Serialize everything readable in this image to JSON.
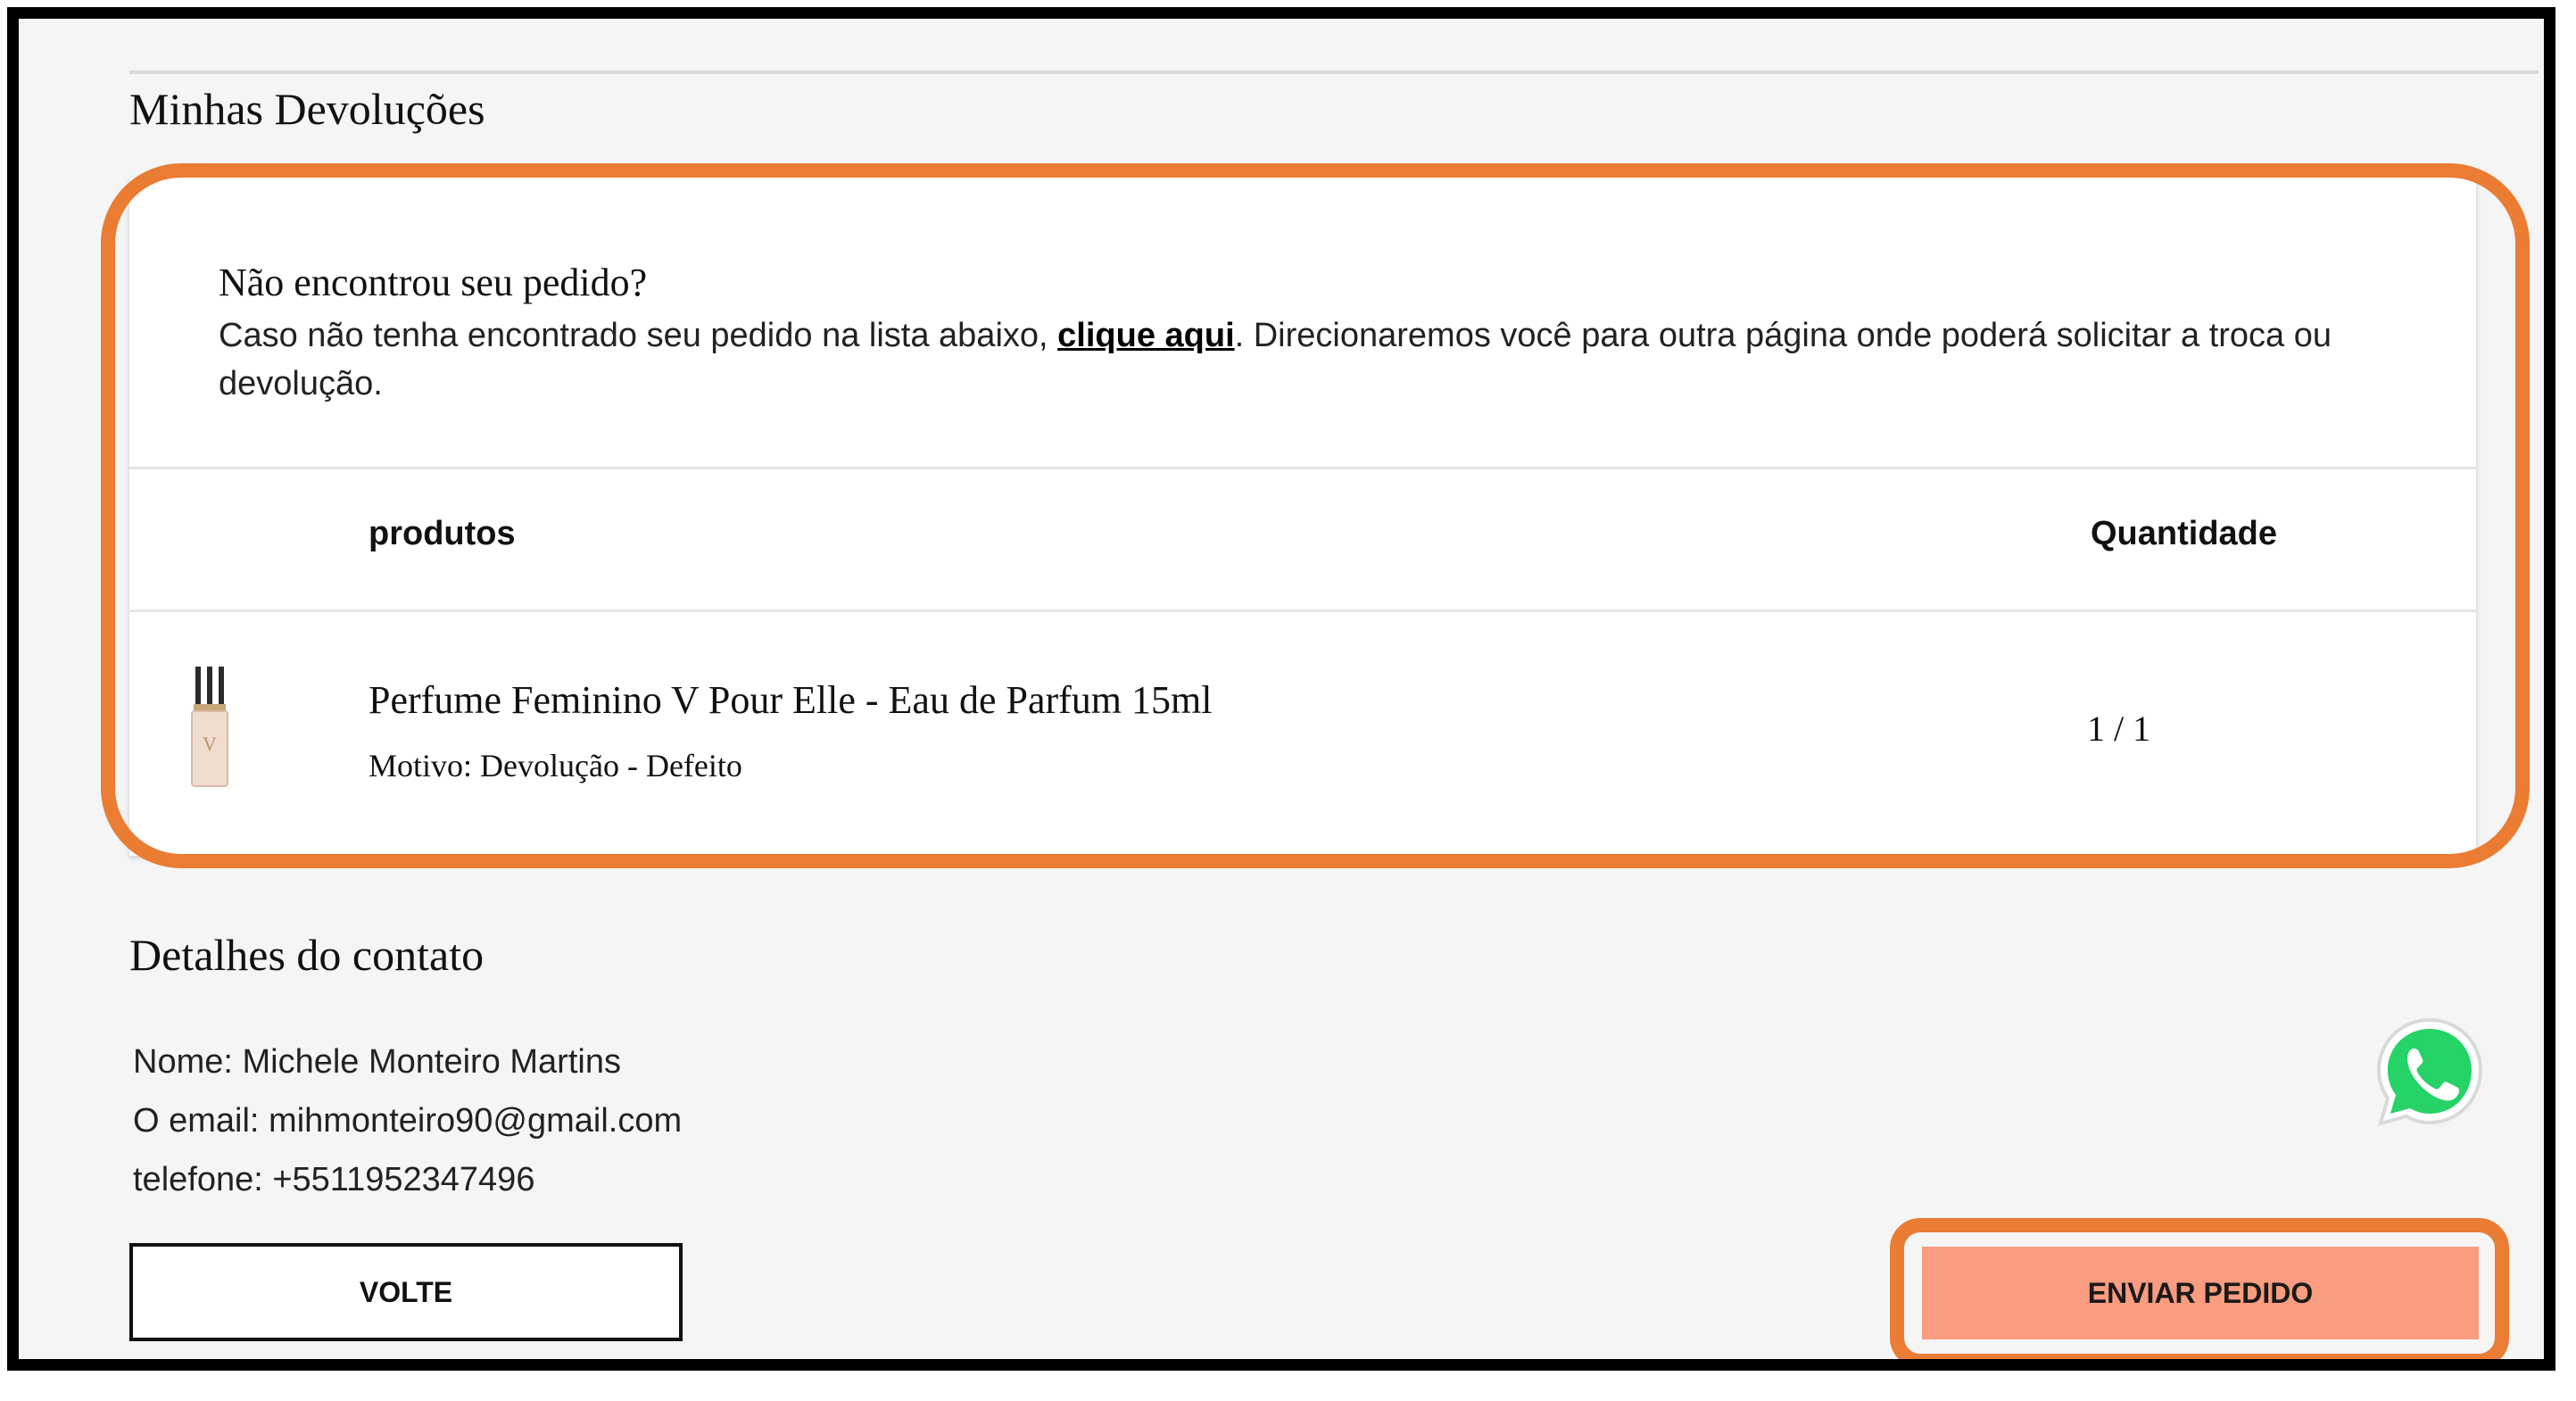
{
  "page": {
    "title": "Minhas Devoluções"
  },
  "notice": {
    "title": "Não encontrou seu pedido?",
    "text_before": "Caso não tenha encontrado seu pedido na lista abaixo, ",
    "link": "clique aqui",
    "text_after": ". Direcionaremos você para outra página onde poderá solicitar a troca ou devolução."
  },
  "table": {
    "headers": {
      "products": "produtos",
      "quantity": "Quantidade"
    },
    "rows": [
      {
        "name": "Perfume Feminino V Pour Elle - Eau de Parfum 15ml",
        "reason": "Motivo: Devolução - Defeito",
        "quantity": "1 / 1",
        "thumbnail_icon": "perfume-bottle-icon"
      }
    ]
  },
  "contact": {
    "title": "Detalhes do contato",
    "name": "Nome: Michele Monteiro Martins",
    "email": "O email: mihmonteiro90@gmail.com",
    "phone": "telefone: +5511952347496"
  },
  "buttons": {
    "back": "VOLTE",
    "send": "ENVIAR PEDIDO"
  },
  "floating": {
    "icon": "whatsapp-icon"
  },
  "colors": {
    "highlight": "#ea7c33",
    "send_button": "#f99c7f",
    "whatsapp": "#25d366"
  }
}
